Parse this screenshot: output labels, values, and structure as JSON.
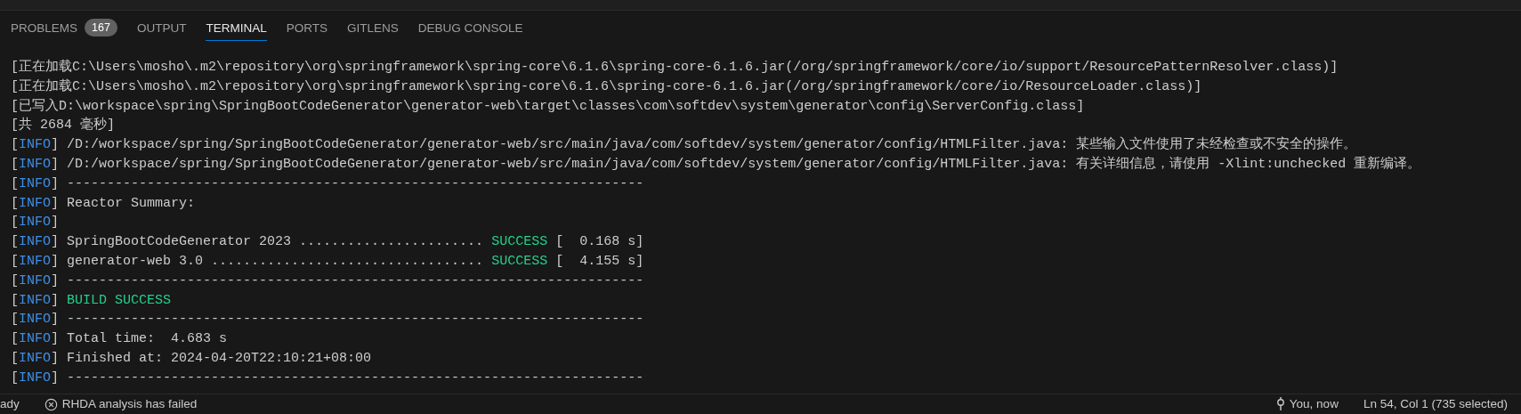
{
  "panel_tabs": [
    {
      "label": "PROBLEMS",
      "badge": "167",
      "selected": false
    },
    {
      "label": "OUTPUT",
      "selected": false
    },
    {
      "label": "TERMINAL",
      "selected": true
    },
    {
      "label": "PORTS",
      "selected": false
    },
    {
      "label": "GITLENS",
      "selected": false
    },
    {
      "label": "DEBUG CONSOLE",
      "selected": false
    }
  ],
  "terminal_lines": [
    [
      {
        "kind": "plain",
        "text": "[正在加载C:\\Users\\mosho\\.m2\\repository\\org\\springframework\\spring-core\\6.1.6\\spring-core-6.1.6.jar(/org/springframework/core/io/support/ResourcePatternResolver.class)]"
      }
    ],
    [
      {
        "kind": "plain",
        "text": "[正在加载C:\\Users\\mosho\\.m2\\repository\\org\\springframework\\spring-core\\6.1.6\\spring-core-6.1.6.jar(/org/springframework/core/io/ResourceLoader.class)]"
      }
    ],
    [
      {
        "kind": "plain",
        "text": "[已写入D:\\workspace\\spring\\SpringBootCodeGenerator\\generator-web\\target\\classes\\com\\softdev\\system\\generator\\config\\ServerConfig.class]"
      }
    ],
    [
      {
        "kind": "plain",
        "text": "[共 2684 毫秒]"
      }
    ],
    [
      {
        "kind": "plain",
        "text": "["
      },
      {
        "kind": "info",
        "text": "INFO"
      },
      {
        "kind": "plain",
        "text": "] /D:/workspace/spring/SpringBootCodeGenerator/generator-web/src/main/java/com/softdev/system/generator/config/HTMLFilter.java: 某些输入文件使用了未经检查或不安全的操作。"
      }
    ],
    [
      {
        "kind": "plain",
        "text": "["
      },
      {
        "kind": "info",
        "text": "INFO"
      },
      {
        "kind": "plain",
        "text": "] /D:/workspace/spring/SpringBootCodeGenerator/generator-web/src/main/java/com/softdev/system/generator/config/HTMLFilter.java: 有关详细信息，请使用 -Xlint:unchecked 重新编译。"
      }
    ],
    [
      {
        "kind": "plain",
        "text": "["
      },
      {
        "kind": "info",
        "text": "INFO"
      },
      {
        "kind": "plain",
        "text": "] ------------------------------------------------------------------------"
      }
    ],
    [
      {
        "kind": "plain",
        "text": "["
      },
      {
        "kind": "info",
        "text": "INFO"
      },
      {
        "kind": "plain",
        "text": "] Reactor Summary:"
      }
    ],
    [
      {
        "kind": "plain",
        "text": "["
      },
      {
        "kind": "info",
        "text": "INFO"
      },
      {
        "kind": "plain",
        "text": "]"
      }
    ],
    [
      {
        "kind": "plain",
        "text": "["
      },
      {
        "kind": "info",
        "text": "INFO"
      },
      {
        "kind": "plain",
        "text": "] SpringBootCodeGenerator 2023 ....................... "
      },
      {
        "kind": "success",
        "text": "SUCCESS"
      },
      {
        "kind": "plain",
        "text": " [  0.168 s]"
      }
    ],
    [
      {
        "kind": "plain",
        "text": "["
      },
      {
        "kind": "info",
        "text": "INFO"
      },
      {
        "kind": "plain",
        "text": "] generator-web 3.0 .................................. "
      },
      {
        "kind": "success",
        "text": "SUCCESS"
      },
      {
        "kind": "plain",
        "text": " [  4.155 s]"
      }
    ],
    [
      {
        "kind": "plain",
        "text": "["
      },
      {
        "kind": "info",
        "text": "INFO"
      },
      {
        "kind": "plain",
        "text": "] ------------------------------------------------------------------------"
      }
    ],
    [
      {
        "kind": "plain",
        "text": "["
      },
      {
        "kind": "info",
        "text": "INFO"
      },
      {
        "kind": "plain",
        "text": "] "
      },
      {
        "kind": "success",
        "text": "BUILD SUCCESS"
      }
    ],
    [
      {
        "kind": "plain",
        "text": "["
      },
      {
        "kind": "info",
        "text": "INFO"
      },
      {
        "kind": "plain",
        "text": "] ------------------------------------------------------------------------"
      }
    ],
    [
      {
        "kind": "plain",
        "text": "["
      },
      {
        "kind": "info",
        "text": "INFO"
      },
      {
        "kind": "plain",
        "text": "] Total time:  4.683 s"
      }
    ],
    [
      {
        "kind": "plain",
        "text": "["
      },
      {
        "kind": "info",
        "text": "INFO"
      },
      {
        "kind": "plain",
        "text": "] Finished at: 2024-04-20T22:10:21+08:00"
      }
    ],
    [
      {
        "kind": "plain",
        "text": "["
      },
      {
        "kind": "info",
        "text": "INFO"
      },
      {
        "kind": "plain",
        "text": "] ------------------------------------------------------------------------"
      }
    ]
  ],
  "status_bar": {
    "left": [
      {
        "kind": "text",
        "text": "ady"
      },
      {
        "kind": "error",
        "text": "RHDA analysis has failed"
      }
    ],
    "right": [
      {
        "kind": "commit",
        "text": "You, now"
      },
      {
        "kind": "text",
        "text": "Ln 54, Col 1 (735 selected)"
      }
    ]
  }
}
